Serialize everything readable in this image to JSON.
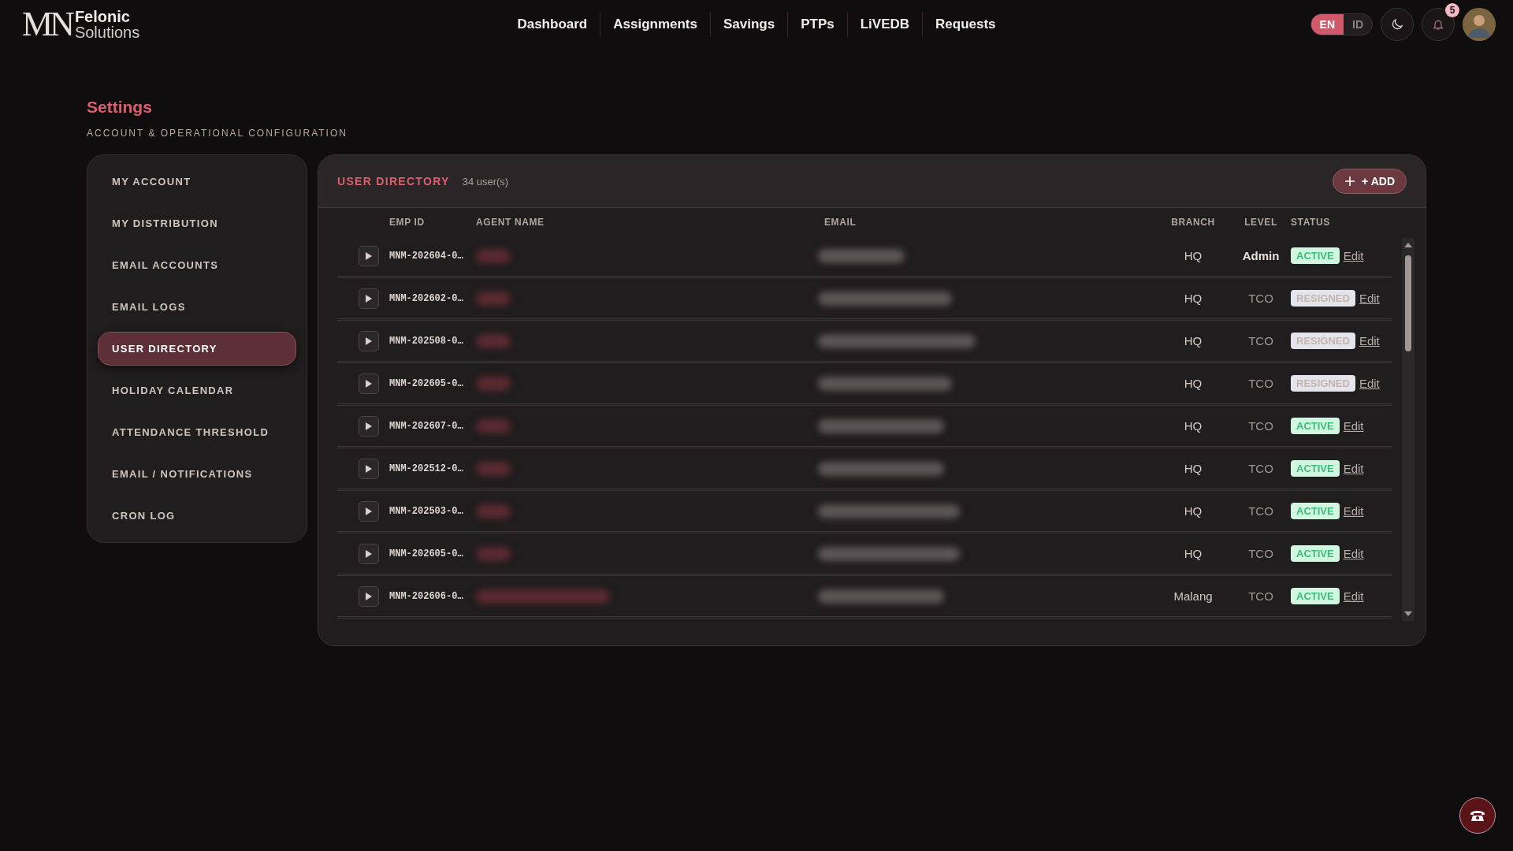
{
  "logo": {
    "mark": "MN",
    "name": "Felonic",
    "tagline": "Solutions"
  },
  "nav": [
    {
      "label": "Dashboard"
    },
    {
      "label": "Assignments"
    },
    {
      "label": "Savings"
    },
    {
      "label": "PTPs"
    },
    {
      "label": "LiVEDB"
    },
    {
      "label": "Requests"
    }
  ],
  "language": [
    {
      "label": "EN",
      "selected": true
    },
    {
      "label": "ID",
      "selected": false
    }
  ],
  "notifications": {
    "count": "5"
  },
  "page": {
    "title": "Settings",
    "subtitle": "ACCOUNT & OPERATIONAL CONFIGURATION"
  },
  "sidebar": {
    "items": [
      {
        "label": "MY ACCOUNT",
        "selected": false
      },
      {
        "label": "MY DISTRIBUTION",
        "selected": false
      },
      {
        "label": "EMAIL ACCOUNTS",
        "selected": false
      },
      {
        "label": "EMAIL LOGS",
        "selected": false
      },
      {
        "label": "USER DIRECTORY",
        "selected": true
      },
      {
        "label": "HOLIDAY CALENDAR",
        "selected": false
      },
      {
        "label": "ATTENDANCE THRESHOLD",
        "selected": false
      },
      {
        "label": "EMAIL / NOTIFICATIONS",
        "selected": false
      },
      {
        "label": "CRON LOG",
        "selected": false
      }
    ]
  },
  "panel": {
    "title": "USER DIRECTORY",
    "count": "34 user(s)",
    "add_button": "+ ADD"
  },
  "table": {
    "columns": [
      "EMP ID",
      "AGENT NAME",
      "EMAIL",
      "BRANCH",
      "LEVEL",
      "STATUS"
    ],
    "rows": [
      {
        "emp_id": "MNM-202604-0…",
        "branch": "HQ",
        "level": "Admin",
        "kind": "admin",
        "status": {
          "label": "ACTIVE",
          "kind": "active"
        },
        "action": "Edit"
      },
      {
        "emp_id": "MNM-202602-0…",
        "branch": "HQ",
        "level": "TCO",
        "kind": "normal",
        "status": {
          "label": "RESIGNED",
          "kind": "resigned"
        },
        "action": "Edit"
      },
      {
        "emp_id": "MNM-202508-0…",
        "branch": "HQ",
        "level": "TCO",
        "kind": "normal",
        "status": {
          "label": "RESIGNED",
          "kind": "resigned"
        },
        "action": "Edit"
      },
      {
        "emp_id": "MNM-202605-0…",
        "branch": "HQ",
        "level": "TCO",
        "kind": "normal",
        "status": {
          "label": "RESIGNED",
          "kind": "resigned"
        },
        "action": "Edit"
      },
      {
        "emp_id": "MNM-202607-0…",
        "branch": "HQ",
        "level": "TCO",
        "kind": "normal",
        "status": {
          "label": "ACTIVE",
          "kind": "active"
        },
        "action": "Edit"
      },
      {
        "emp_id": "MNM-202512-0…",
        "branch": "HQ",
        "level": "TCO",
        "kind": "normal",
        "status": {
          "label": "ACTIVE",
          "kind": "active"
        },
        "action": "Edit"
      },
      {
        "emp_id": "MNM-202503-0…",
        "branch": "HQ",
        "level": "TCO",
        "kind": "normal",
        "status": {
          "label": "ACTIVE",
          "kind": "active"
        },
        "action": "Edit"
      },
      {
        "emp_id": "MNM-202605-0…",
        "branch": "HQ",
        "level": "TCO",
        "kind": "normal",
        "status": {
          "label": "ACTIVE",
          "kind": "active"
        },
        "action": "Edit"
      },
      {
        "emp_id": "MNM-202606-0…",
        "branch": "Malang",
        "level": "TCO",
        "kind": "normal",
        "status": {
          "label": "ACTIVE",
          "kind": "active"
        },
        "action": "Edit"
      }
    ]
  }
}
